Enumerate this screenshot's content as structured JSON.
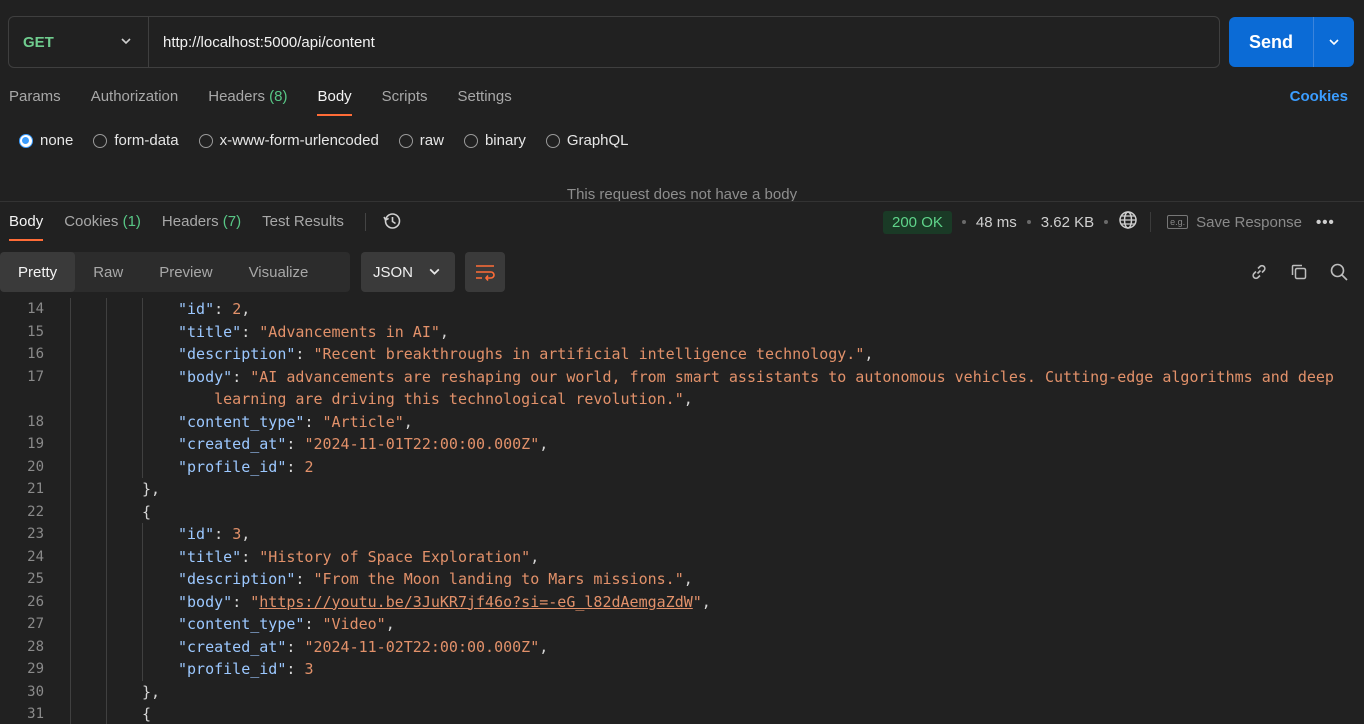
{
  "request": {
    "method": "GET",
    "url": "http://localhost:5000/api/content",
    "send_label": "Send",
    "tabs": [
      {
        "label": "Params"
      },
      {
        "label": "Authorization"
      },
      {
        "label": "Headers",
        "count": "(8)"
      },
      {
        "label": "Body"
      },
      {
        "label": "Scripts"
      },
      {
        "label": "Settings"
      }
    ],
    "active_tab": "Body",
    "cookies_link": "Cookies",
    "body_types": [
      "none",
      "form-data",
      "x-www-form-urlencoded",
      "raw",
      "binary",
      "GraphQL"
    ],
    "selected_body_type": "none",
    "no_body_message": "This request does not have a body"
  },
  "response": {
    "tabs": [
      {
        "label": "Body"
      },
      {
        "label": "Cookies",
        "count": "(1)"
      },
      {
        "label": "Headers",
        "count": "(7)"
      },
      {
        "label": "Test Results"
      }
    ],
    "status": "200 OK",
    "time": "48 ms",
    "size": "3.62 KB",
    "save_label": "Save Response",
    "view_tabs": [
      "Pretty",
      "Raw",
      "Preview",
      "Visualize"
    ],
    "active_view": "Pretty",
    "format": "JSON",
    "lines": [
      {
        "n": "14",
        "indent": 2,
        "key": "id",
        "num": "2",
        "tail": ","
      },
      {
        "n": "15",
        "indent": 2,
        "key": "title",
        "str": "\"Advancements in AI\"",
        "tail": ","
      },
      {
        "n": "16",
        "indent": 2,
        "key": "description",
        "str": "\"Recent breakthroughs in artificial intelligence technology.\"",
        "tail": ","
      },
      {
        "n": "17",
        "indent": 2,
        "key": "body",
        "str": "\"AI advancements are reshaping our world, from smart assistants to autonomous vehicles. Cutting-edge algorithms and deep",
        "tail": ""
      },
      {
        "n": "",
        "indent": 2,
        "cont": "    learning are driving this technological revolution.\"",
        "tail": ","
      },
      {
        "n": "18",
        "indent": 2,
        "key": "content_type",
        "str": "\"Article\"",
        "tail": ","
      },
      {
        "n": "19",
        "indent": 2,
        "key": "created_at",
        "str": "\"2024-11-01T22:00:00.000Z\"",
        "tail": ","
      },
      {
        "n": "20",
        "indent": 2,
        "key": "profile_id",
        "num": "2",
        "tail": ""
      },
      {
        "n": "21",
        "indent": 1,
        "brace": "},"
      },
      {
        "n": "22",
        "indent": 1,
        "brace": "{"
      },
      {
        "n": "23",
        "indent": 2,
        "key": "id",
        "num": "3",
        "tail": ","
      },
      {
        "n": "24",
        "indent": 2,
        "key": "title",
        "str": "\"History of Space Exploration\"",
        "tail": ","
      },
      {
        "n": "25",
        "indent": 2,
        "key": "description",
        "str": "\"From the Moon landing to Mars missions.\"",
        "tail": ","
      },
      {
        "n": "26",
        "indent": 2,
        "key": "body",
        "url": "https://youtu.be/3JuKR7jf46o?si=-eG_l82dAemgaZdW",
        "tail": ","
      },
      {
        "n": "27",
        "indent": 2,
        "key": "content_type",
        "str": "\"Video\"",
        "tail": ","
      },
      {
        "n": "28",
        "indent": 2,
        "key": "created_at",
        "str": "\"2024-11-02T22:00:00.000Z\"",
        "tail": ","
      },
      {
        "n": "29",
        "indent": 2,
        "key": "profile_id",
        "num": "3",
        "tail": ""
      },
      {
        "n": "30",
        "indent": 1,
        "brace": "},"
      },
      {
        "n": "31",
        "indent": 1,
        "brace": "{"
      }
    ]
  },
  "colors": {
    "accent": "#ff6c37",
    "send": "#0b6bd6",
    "method": "#6fcc8e",
    "json_key": "#9cc8ff",
    "json_string": "#e2916a"
  }
}
